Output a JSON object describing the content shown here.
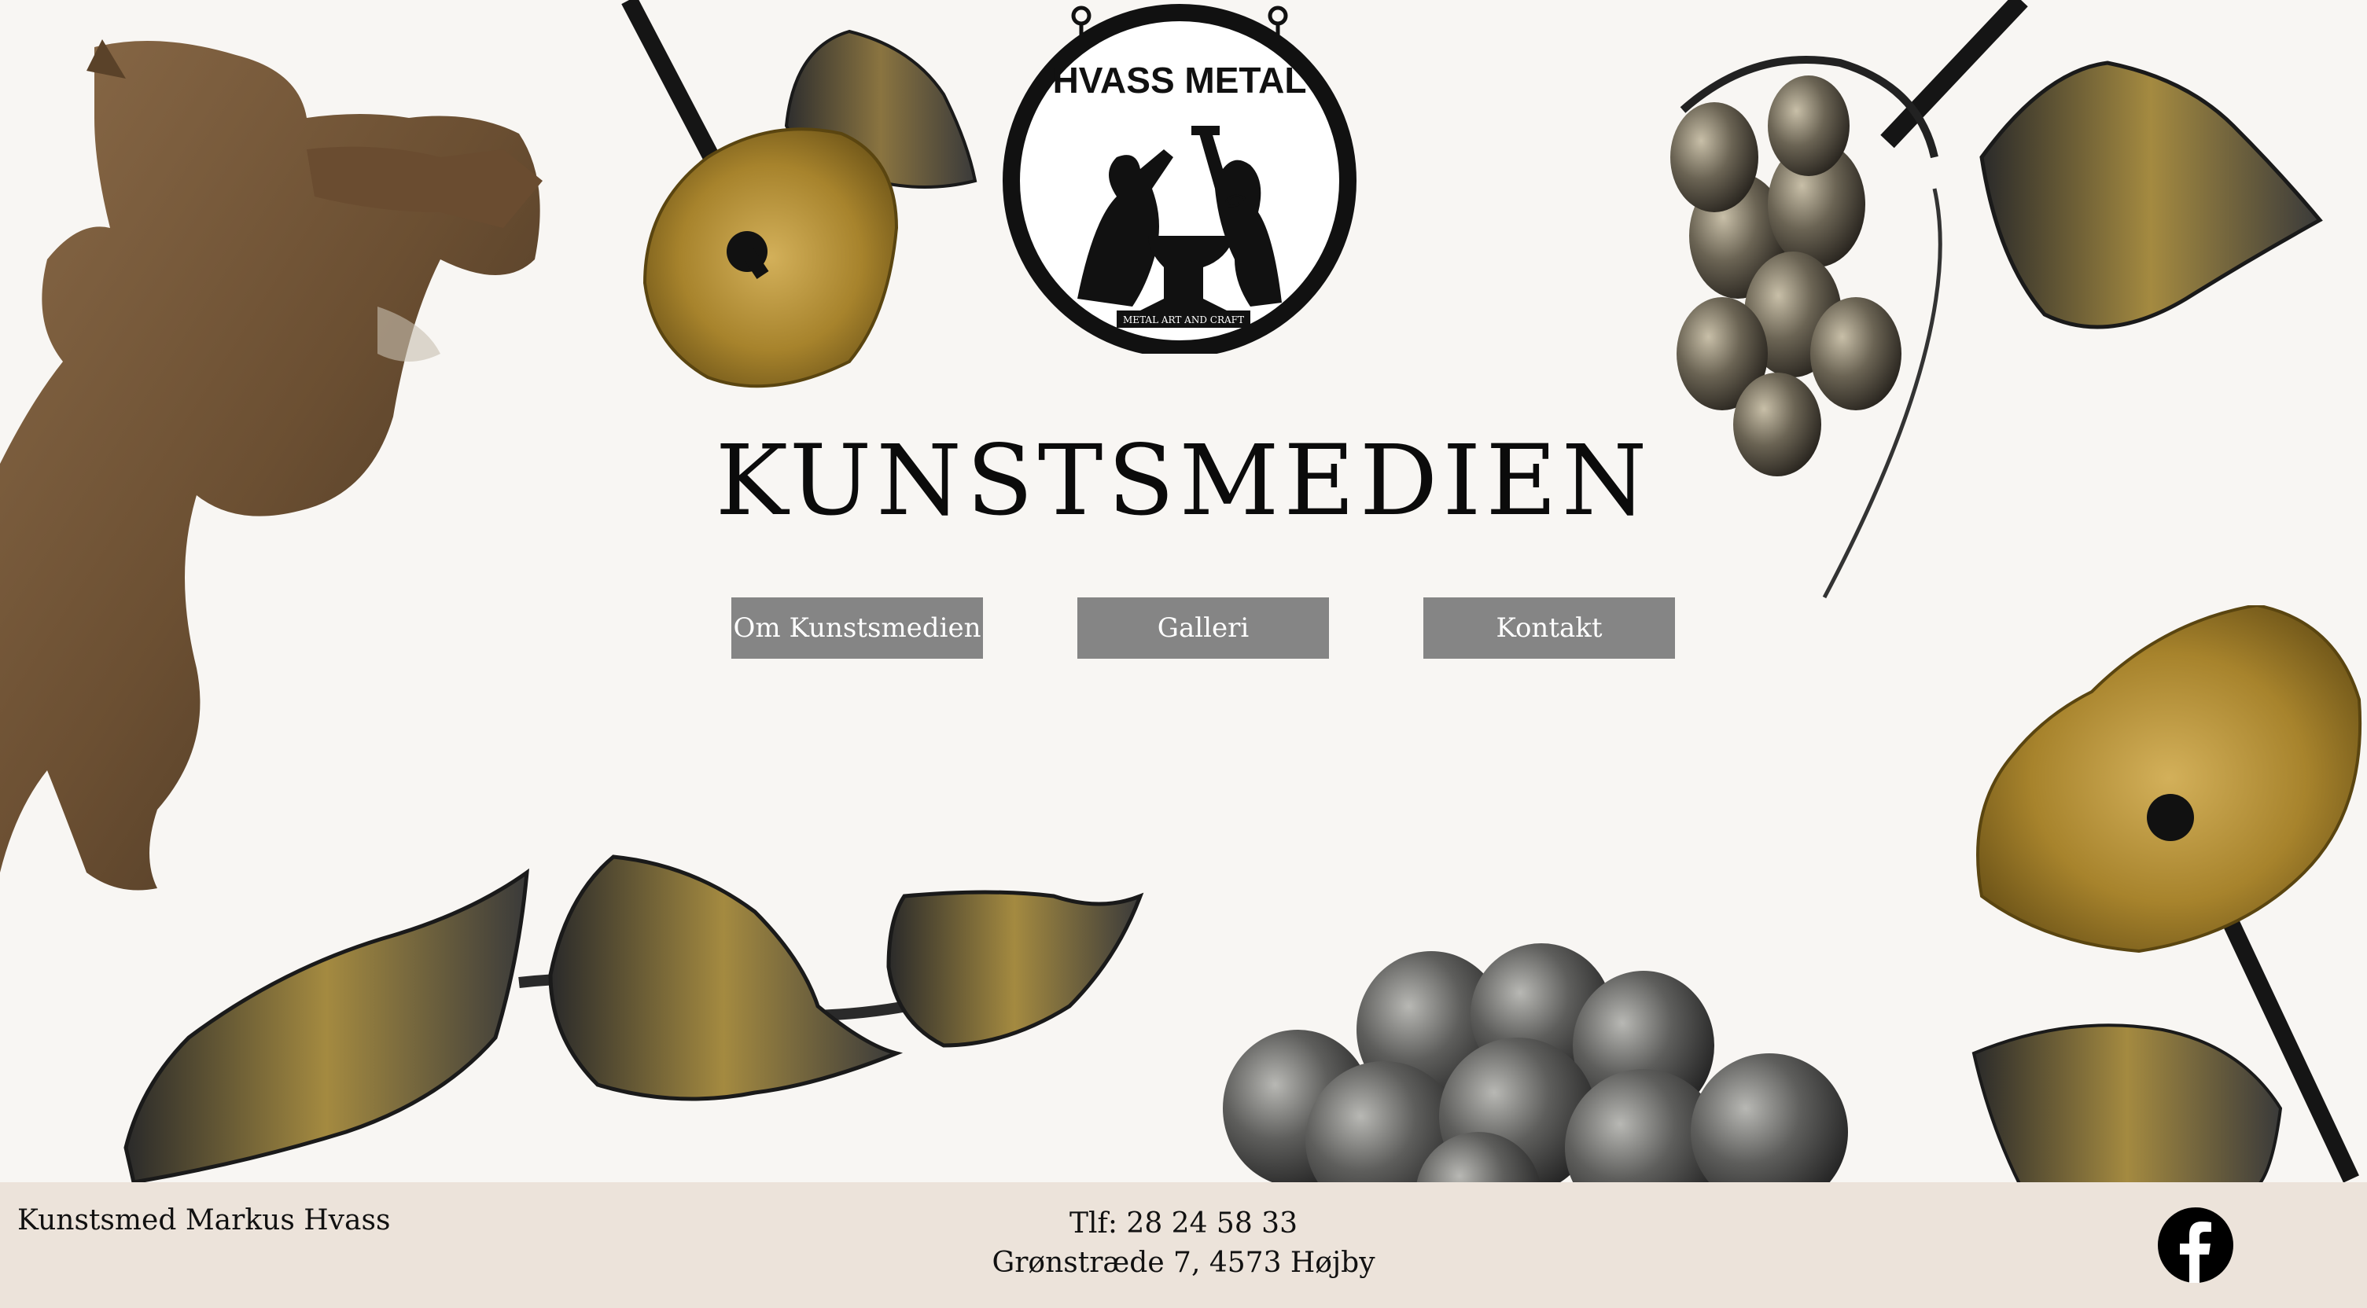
{
  "header": {
    "logo": {
      "name": "hvass-metal-logo",
      "text_top": "HVASS METAL",
      "text_bottom": "METAL ART AND CRAFT"
    }
  },
  "main": {
    "title": "KUNSTSMEDIEN",
    "nav": [
      {
        "label": "Om Kunstsmedien"
      },
      {
        "label": "Galleri"
      },
      {
        "label": "Kontakt"
      }
    ]
  },
  "footer": {
    "name": "Kunstsmed Markus Hvass",
    "phone": "Tlf: 28 24 58 33",
    "address": "Grønstræde 7, 4573 Højby",
    "social_icon": "facebook-icon"
  },
  "colors": {
    "background": "#f8f6f3",
    "nav_button": "#858585",
    "footer": "#ece3da",
    "bronze": "#7a5a3a",
    "brass": "#b08a2e",
    "steel": "#4a4a4a"
  }
}
